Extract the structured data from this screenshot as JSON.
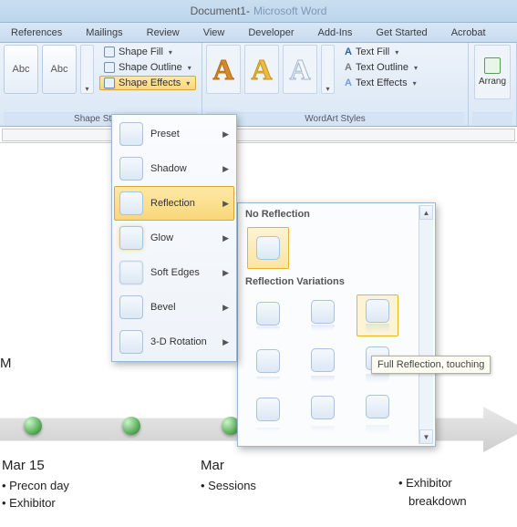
{
  "title": {
    "doc": "Document1",
    "sep": " - ",
    "app": "Microsoft Word"
  },
  "tabs": [
    "References",
    "Mailings",
    "Review",
    "View",
    "Developer",
    "Add-Ins",
    "Get Started",
    "Acrobat"
  ],
  "ribbon": {
    "shape_styles": {
      "label": "Shape Styles",
      "sample": "Abc",
      "fill": "Shape Fill",
      "outline": "Shape Outline",
      "effects": "Shape Effects"
    },
    "wordart": {
      "label": "WordArt Styles",
      "text_fill": "Text Fill",
      "text_outline": "Text Outline",
      "text_effects": "Text Effects"
    },
    "arrange": {
      "label": "Arrang"
    }
  },
  "effects_menu": {
    "items": [
      {
        "label": "Preset"
      },
      {
        "label": "Shadow"
      },
      {
        "label": "Reflection",
        "selected": true
      },
      {
        "label": "Glow"
      },
      {
        "label": "Soft Edges"
      },
      {
        "label": "Bevel"
      },
      {
        "label": "3-D Rotation"
      }
    ]
  },
  "gallery": {
    "hdr_none": "No Reflection",
    "hdr_var": "Reflection Variations",
    "tooltip": "Full Reflection, touching"
  },
  "document": {
    "m_clip": "M",
    "col1": {
      "head": "Mar 15",
      "b1": "Precon day",
      "b2": "Exhibitor"
    },
    "col2": {
      "head": "Mar",
      "b1": "Sessions"
    },
    "col3": {
      "b1": "Exhibitor",
      "b2": "breakdown"
    }
  }
}
